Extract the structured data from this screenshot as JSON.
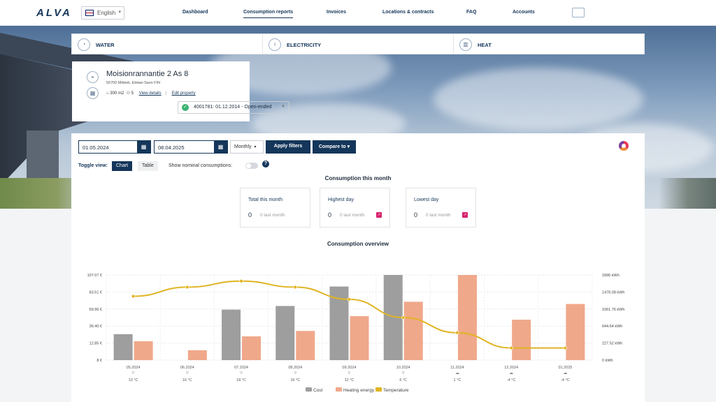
{
  "header": {
    "logo": "ALVA",
    "language": "English",
    "nav": [
      "Dashboard",
      "Consumption reports",
      "Invoices",
      "Locations & contracts",
      "FAQ",
      "Accounts"
    ]
  },
  "tabs": [
    {
      "label": "WATER",
      "icon": "water-drop-icon"
    },
    {
      "label": "ELECTRICITY",
      "icon": "lightbulb-icon"
    },
    {
      "label": "HEAT",
      "icon": "radiator-icon"
    }
  ],
  "property": {
    "address": "Moisionrannantie 2 As 8",
    "city": "50700 Mikkeli, Etelae-Savo FIN",
    "area": "300 m2",
    "residents": "5",
    "view_details": "View details",
    "edit_property": "Edit property",
    "contract": "4001781: 01.12.2014 - Open-ended"
  },
  "filters": {
    "start_date": "01.05.2024",
    "end_date": "08.04.2025",
    "interval": "Monthly",
    "apply": "Apply filters",
    "compare": "Compare to"
  },
  "view": {
    "toggle_label": "Toggle view:",
    "chart": "Chart",
    "table": "Table",
    "nominal": "Show nominal consumptions:"
  },
  "month_summary": {
    "title": "Consumption this month",
    "cards": [
      {
        "title": "Total this month",
        "value": "0",
        "note": "0 last month",
        "badge": false
      },
      {
        "title": "Highest day",
        "value": "0",
        "note": "0 last month",
        "badge": true
      },
      {
        "title": "Lowest day",
        "value": "0",
        "note": "0 last month",
        "badge": true
      }
    ]
  },
  "overview_title": "Consumption overview",
  "colors": {
    "navy": "#14365a",
    "cost": "#9e9e9e",
    "energy": "#f0a88a",
    "temperature": "#e0b423"
  },
  "chart_data": {
    "type": "bar",
    "categories": [
      "05.2024",
      "06.2024",
      "07.2024",
      "08.2024",
      "09.2024",
      "10.2024",
      "11.2024",
      "12.2024",
      "01.2025"
    ],
    "temperature_labels": [
      "13 °C",
      "16 °C",
      "18 °C",
      "16 °C",
      "12 °C",
      "6 °C",
      "1 °C",
      "-4 °C",
      "-4 °C"
    ],
    "weather_icons": [
      "sun-icon",
      "sun-icon",
      "sun-icon",
      "sun-icon",
      "sun-icon",
      "sun-icon",
      "cloud-icon",
      "cloud-icon",
      "cloud-icon"
    ],
    "left_ticks": [
      "107.07 €",
      "83.51 €",
      "59.96 €",
      "36.40 €",
      "12.85 €",
      "8 €"
    ],
    "right_ticks": [
      "1896 kWh",
      "1478.08 kWh",
      "1061.76 kWh",
      "644.64 kWh",
      "227.52 kWh",
      "0 kWh"
    ],
    "series": [
      {
        "name": "Cost",
        "unit": "€",
        "values": [
          36,
          null,
          70,
          75,
          102,
          118,
          null,
          null,
          null
        ]
      },
      {
        "name": "Heating energy",
        "unit": "kWh",
        "values": [
          420,
          220,
          530,
          650,
          980,
          1300,
          1896,
          900,
          1250
        ]
      },
      {
        "name": "Temperature",
        "unit": "°C",
        "values": [
          13,
          16,
          18,
          16,
          12,
          6,
          1,
          -4,
          -4
        ]
      }
    ],
    "legend": [
      "Cost",
      "Heating energy",
      "Temperature"
    ],
    "legend_position": "bottom"
  }
}
